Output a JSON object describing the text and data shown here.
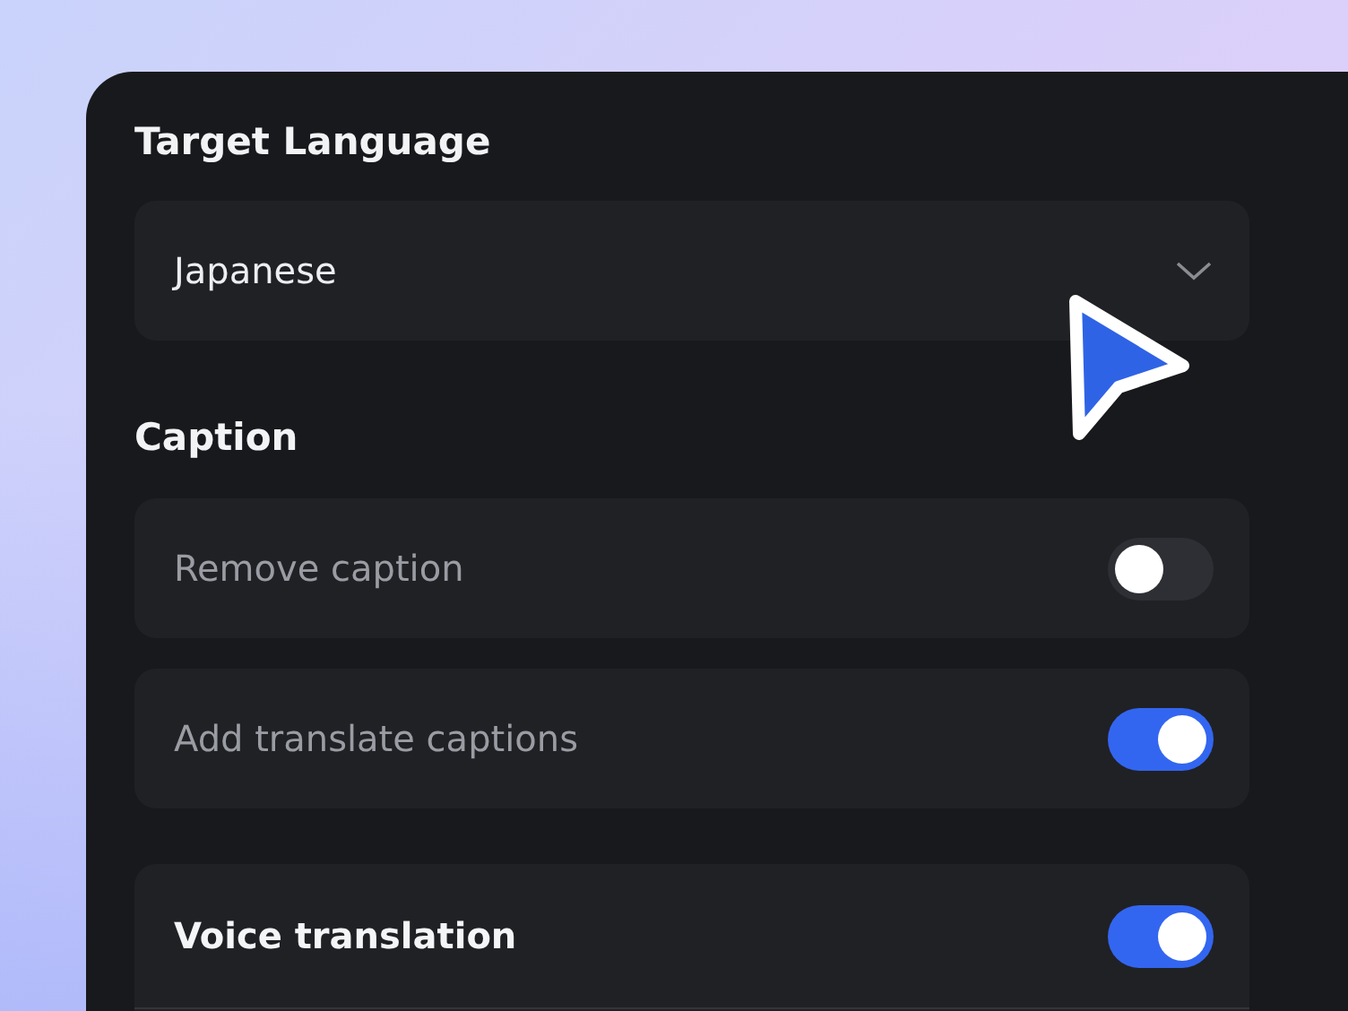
{
  "target_language": {
    "label": "Target Language",
    "dropdown": {
      "value": "Japanese"
    }
  },
  "caption": {
    "label": "Caption",
    "options": [
      {
        "label": "Remove caption",
        "on": false
      },
      {
        "label": "Add translate captions",
        "on": true
      }
    ]
  },
  "voice_translation": {
    "label": "Voice translation",
    "on": true
  }
}
